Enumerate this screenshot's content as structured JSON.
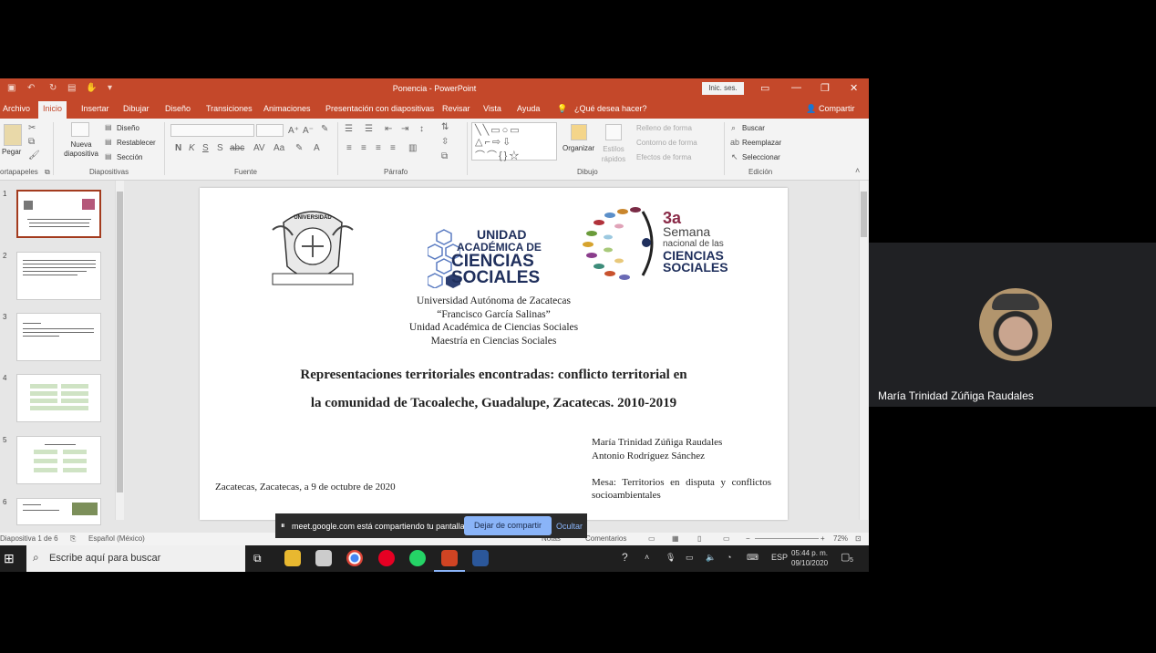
{
  "window": {
    "title": "Ponencia - PowerPoint",
    "signin_label": "Inic. ses."
  },
  "tabs": [
    "Archivo",
    "Inicio",
    "Insertar",
    "Dibujar",
    "Diseño",
    "Transiciones",
    "Animaciones",
    "Presentación con diapositivas",
    "Revisar",
    "Vista",
    "Ayuda"
  ],
  "tell_me": "¿Qué desea hacer?",
  "share_label": "Compartir",
  "ribbon": {
    "paste": "Pegar",
    "new_slide": "Nueva diapositiva",
    "design": "Diseño",
    "reset": "Restablecer",
    "section": "Sección",
    "arrange": "Organizar",
    "quick_styles": "Estilos rápidos",
    "shape_fill": "Relleno de forma",
    "shape_outline": "Contorno de forma",
    "shape_effects": "Efectos de forma",
    "find": "Buscar",
    "replace": "Reemplazar",
    "select": "Seleccionar",
    "groups": {
      "clipboard": "ortapapeles",
      "slides": "Diapositivas",
      "font": "Fuente",
      "paragraph": "Párrafo",
      "drawing": "Dibujo",
      "editing": "Edición"
    }
  },
  "thumbnails": [
    "1",
    "2",
    "3",
    "4",
    "5",
    "6"
  ],
  "slide": {
    "logo_uac_1": "UNIDAD",
    "logo_uac_2": "ACADÉMICA DE",
    "logo_uac_3": "CIENCIAS",
    "logo_uac_4": "SOCIALES",
    "seal_text": "UNIVERSIDAD",
    "semana_1": "3a",
    "semana_2": "Semana",
    "semana_3": "nacional de las",
    "semana_4": "CIENCIAS",
    "semana_5": "SOCIALES",
    "institution": [
      "Universidad Autónoma de Zacatecas",
      "“Francisco García Salinas”",
      "Unidad Académica de Ciencias Sociales",
      "Maestría en Ciencias Sociales"
    ],
    "title_line1": "Representaciones territoriales encontradas: conflicto territorial en",
    "title_line2": "la comunidad de Tacoaleche, Guadalupe, Zacatecas. 2010-2019",
    "author1": "María Trinidad Zúñiga Raudales",
    "author2": "Antonio Rodríguez Sánchez",
    "place_date": "Zacatecas, Zacatecas, a 9 de octubre de 2020",
    "table_label": "Mesa: Territorios en disputa y conflictos socioambientales"
  },
  "status": {
    "slide_counter": "Diapositiva 1 de 6",
    "language": "Español (México)",
    "notes": "Notas",
    "comments": "Comentarios",
    "zoom": "72%"
  },
  "share_bar": {
    "message": "meet.google.com está compartiendo tu pantalla.",
    "stop_label": "Dejar de compartir",
    "hide_label": "Ocultar"
  },
  "taskbar": {
    "search_placeholder": "Escribe aquí para buscar",
    "language": "ESP",
    "time": "05:44 p. m.",
    "date": "09/10/2020",
    "notification_count": "5"
  },
  "participant": {
    "name": "María Trinidad Zúñiga Raudales"
  }
}
